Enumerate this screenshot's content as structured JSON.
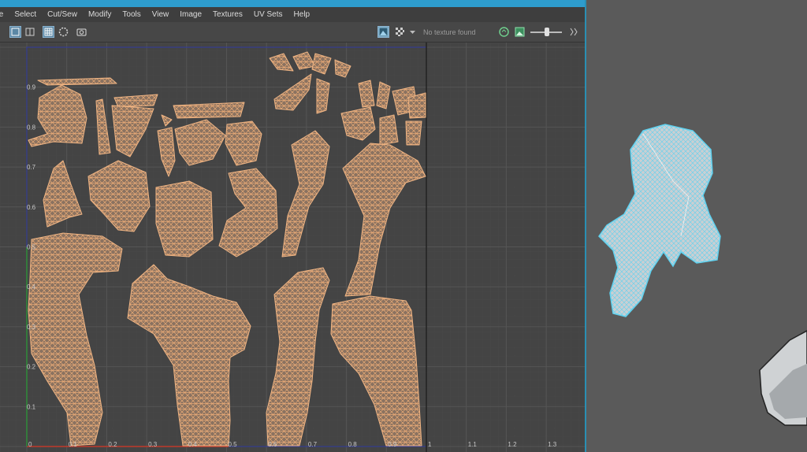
{
  "menu": [
    "te",
    "Select",
    "Cut/Sew",
    "Modify",
    "Tools",
    "View",
    "Image",
    "Textures",
    "UV Sets",
    "Help"
  ],
  "toolbar": {
    "texture_status": "No texture found",
    "icons_left": [
      "single-view-icon",
      "split-view-icon",
      "grid-toggle-icon",
      "shaded-uv-icon",
      "snapshot-icon"
    ],
    "icons_right": [
      "display-image-icon",
      "checker-icon",
      "dropdown-arrow-icon",
      "texture-refresh-icon",
      "image-icon",
      "exposure-slider",
      "expand-icon"
    ]
  },
  "uv_editor": {
    "x_ticks": [
      "0",
      "0.1",
      "0.2",
      "0.3",
      "0.4",
      "0.5",
      "0.6",
      "0.7",
      "0.8",
      "0.9",
      "1",
      "1.1",
      "1.2",
      "1.3"
    ],
    "y_ticks": [
      "0.1",
      "0.2",
      "0.3",
      "0.4",
      "0.5",
      "0.6",
      "0.7",
      "0.8",
      "0.9"
    ],
    "uv_shell_color": "#e9aa76",
    "grid_color": "#555555",
    "axis_u_color": "#c0392b",
    "axis_v_color": "#2e8b3a",
    "border_color": "#2f3aa0"
  },
  "viewport": {
    "mesh_wire_color": "#5fd2f0",
    "mesh_fill_color": "#c9cfd3",
    "background": "#5a5a5a"
  }
}
